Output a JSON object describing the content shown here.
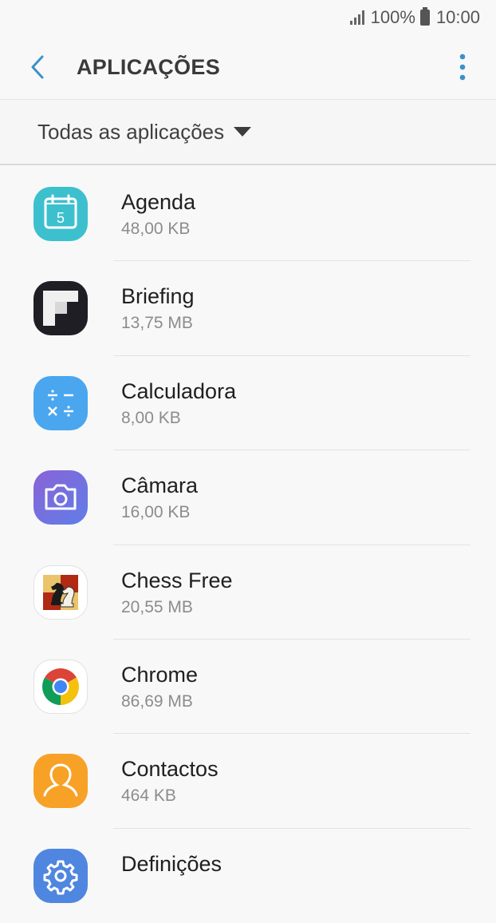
{
  "status_bar": {
    "battery": "100%",
    "time": "10:00"
  },
  "app_bar": {
    "title": "APLICAÇÕES",
    "back_icon": "chevron-left-icon",
    "more_icon": "more-vert-icon"
  },
  "filter": {
    "label": "Todas as aplicações",
    "icon": "caret-down-icon"
  },
  "colors": {
    "accent": "#3d90c8",
    "background": "#f8f8f8"
  },
  "apps": [
    {
      "name": "Agenda",
      "size": "48,00 KB",
      "icon": "calendar-icon"
    },
    {
      "name": "Briefing",
      "size": "13,75 MB",
      "icon": "flipboard-icon"
    },
    {
      "name": "Calculadora",
      "size": "8,00 KB",
      "icon": "calculator-icon"
    },
    {
      "name": "Câmara",
      "size": "16,00 KB",
      "icon": "camera-icon"
    },
    {
      "name": "Chess Free",
      "size": "20,55 MB",
      "icon": "chess-icon"
    },
    {
      "name": "Chrome",
      "size": "86,69 MB",
      "icon": "chrome-icon"
    },
    {
      "name": "Contactos",
      "size": "464 KB",
      "icon": "contacts-icon"
    },
    {
      "name": "Definições",
      "size": "",
      "icon": "settings-gear-icon"
    }
  ],
  "calendar_icon_day": "5"
}
